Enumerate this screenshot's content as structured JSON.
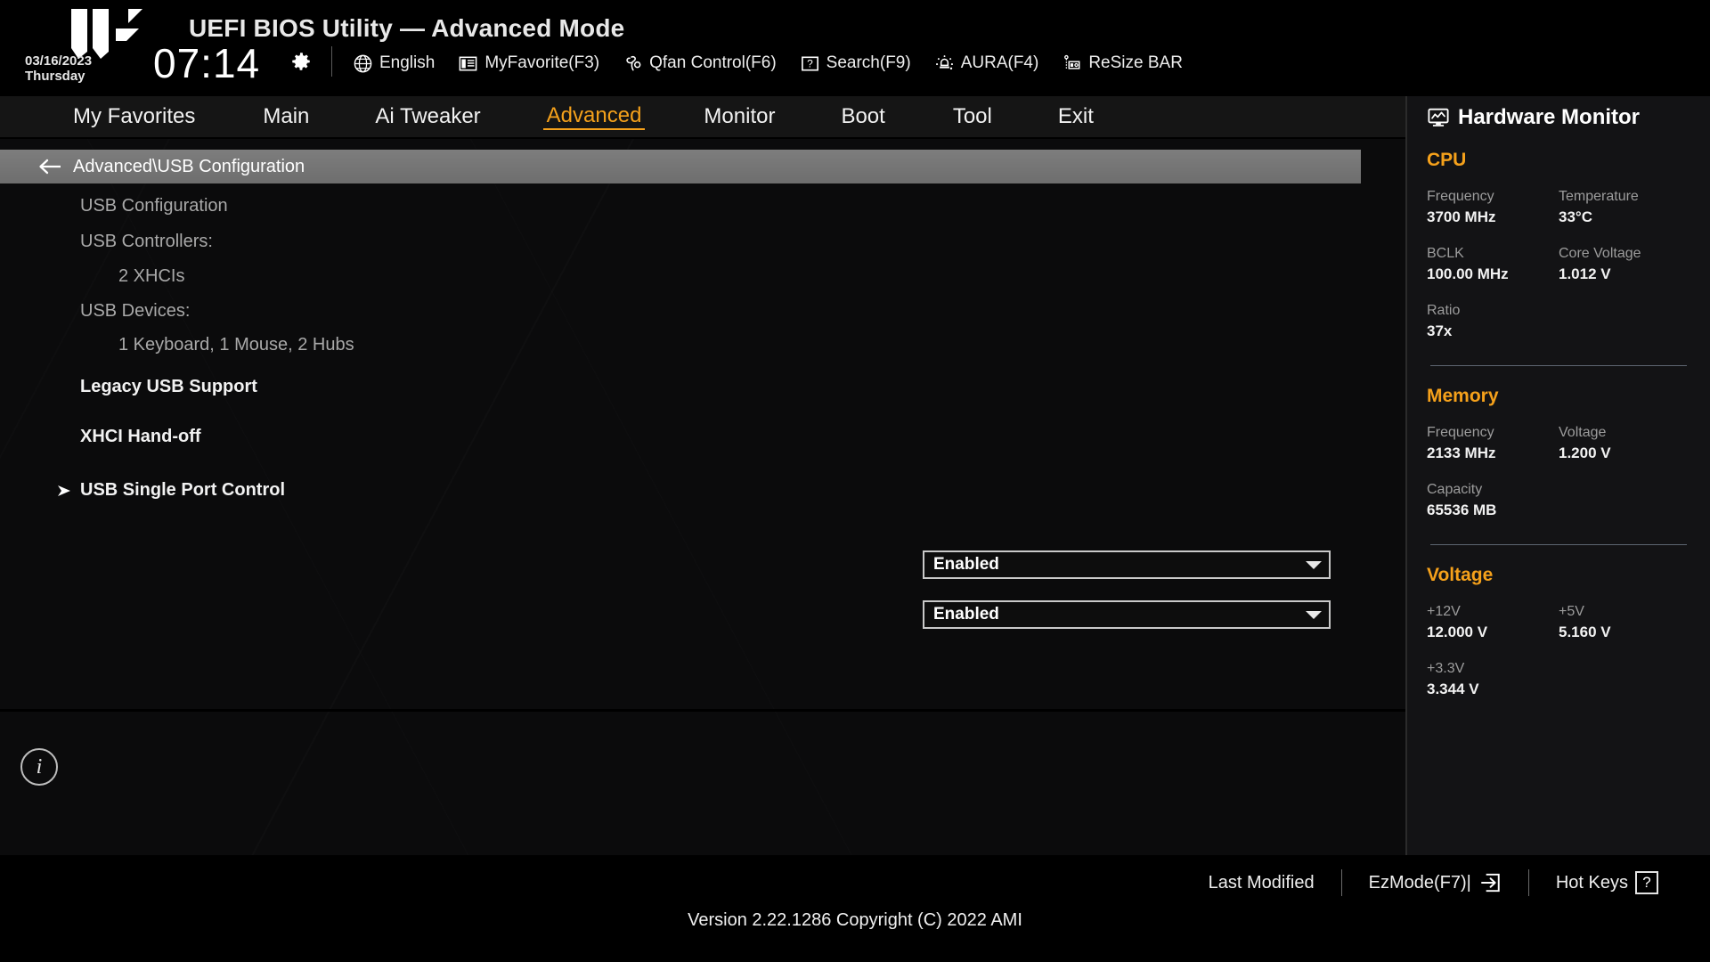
{
  "header": {
    "title": "UEFI BIOS Utility — Advanced Mode",
    "date": "03/16/2023",
    "weekday": "Thursday",
    "time": "07:14",
    "gear_icon": "gear-icon",
    "toolbar": [
      {
        "label": "English",
        "icon": "globe-icon"
      },
      {
        "label": "MyFavorite(F3)",
        "icon": "list-icon"
      },
      {
        "label": "Qfan Control(F6)",
        "icon": "fan-icon"
      },
      {
        "label": "Search(F9)",
        "icon": "question-box-icon"
      },
      {
        "label": "AURA(F4)",
        "icon": "aura-light-icon"
      },
      {
        "label": "ReSize BAR",
        "icon": "resize-bar-icon"
      }
    ]
  },
  "nav": {
    "tabs": [
      {
        "label": "My Favorites",
        "active": false
      },
      {
        "label": "Main",
        "active": false
      },
      {
        "label": "Ai Tweaker",
        "active": false
      },
      {
        "label": "Advanced",
        "active": true
      },
      {
        "label": "Monitor",
        "active": false
      },
      {
        "label": "Boot",
        "active": false
      },
      {
        "label": "Tool",
        "active": false
      },
      {
        "label": "Exit",
        "active": false
      }
    ],
    "active_color": "#f5a11b"
  },
  "breadcrumb": {
    "back_icon": "back-arrow-icon",
    "path": "Advanced\\USB Configuration"
  },
  "main": {
    "section_title": "USB Configuration",
    "controllers_label": "USB Controllers:",
    "controllers_value": "2 XHCIs",
    "devices_label": "USB Devices:",
    "devices_value": "1 Keyboard, 1 Mouse, 2 Hubs",
    "settings": [
      {
        "label": "Legacy USB Support",
        "value": "Enabled"
      },
      {
        "label": "XHCI Hand-off",
        "value": "Enabled"
      }
    ],
    "submenu": {
      "label": "USB Single Port Control",
      "arrow_icon": "submenu-arrow-icon"
    },
    "info_icon": "info-icon"
  },
  "hardware_monitor": {
    "title": "Hardware Monitor",
    "title_icon": "monitor-graph-icon",
    "sections": [
      {
        "name": "CPU",
        "items": [
          {
            "key": "Frequency",
            "value": "3700 MHz"
          },
          {
            "key": "Temperature",
            "value": "33°C"
          },
          {
            "key": "BCLK",
            "value": "100.00 MHz"
          },
          {
            "key": "Core Voltage",
            "value": "1.012 V"
          },
          {
            "key": "Ratio",
            "value": "37x"
          }
        ]
      },
      {
        "name": "Memory",
        "items": [
          {
            "key": "Frequency",
            "value": "2133 MHz"
          },
          {
            "key": "Voltage",
            "value": "1.200 V"
          },
          {
            "key": "Capacity",
            "value": "65536 MB"
          }
        ]
      },
      {
        "name": "Voltage",
        "items": [
          {
            "key": "+12V",
            "value": "12.000 V"
          },
          {
            "key": "+5V",
            "value": "5.160 V"
          },
          {
            "key": "+3.3V",
            "value": "3.344 V"
          }
        ]
      }
    ]
  },
  "footer": {
    "last_modified": "Last Modified",
    "ezmode": "EzMode(F7)|",
    "ezmode_icon": "arrow-into-box-icon",
    "hotkeys": "Hot Keys",
    "hotkeys_icon": "question-box-icon",
    "version": "Version 2.22.1286 Copyright (C) 2022 AMI"
  }
}
